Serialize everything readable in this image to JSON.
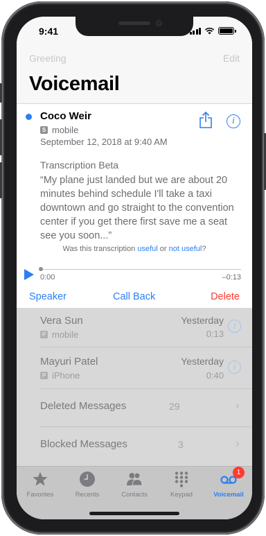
{
  "status": {
    "time": "9:41"
  },
  "nav": {
    "left_button": "Greeting",
    "right_button": "Edit",
    "title": "Voicemail"
  },
  "selected_voicemail": {
    "name": "Coco Weir",
    "label_badge": "S",
    "label": "mobile",
    "date": "September 12, 2018 at 9:40 AM",
    "transcription_heading": "Transcription Beta",
    "transcription": "“My plane just landed but we are about 20 minutes behind schedule I'll take a taxi downtown and go straight to the convention center if you get there first save me a seat see you soon...”",
    "feedback_prefix": "Was this transcription ",
    "feedback_useful": "useful",
    "feedback_or": " or ",
    "feedback_not_useful": "not useful",
    "feedback_suffix": "?",
    "elapsed": "0:00",
    "remaining": "–0:13",
    "progress": 0,
    "actions": {
      "speaker": "Speaker",
      "call_back": "Call Back",
      "delete": "Delete"
    }
  },
  "voicemails": [
    {
      "name": "Vera Sun",
      "badge": "P",
      "label": "mobile",
      "date": "Yesterday",
      "duration": "0:13"
    },
    {
      "name": "Mayuri Patel",
      "badge": "P",
      "label": "iPhone",
      "date": "Yesterday",
      "duration": "0:40"
    }
  ],
  "mailboxes": [
    {
      "name": "Deleted Messages",
      "count": "29"
    },
    {
      "name": "Blocked Messages",
      "count": "3"
    }
  ],
  "tabs": [
    {
      "label": "Favorites",
      "icon": "star-icon"
    },
    {
      "label": "Recents",
      "icon": "clock-icon"
    },
    {
      "label": "Contacts",
      "icon": "contacts-icon"
    },
    {
      "label": "Keypad",
      "icon": "keypad-icon"
    },
    {
      "label": "Voicemail",
      "icon": "voicemail-icon",
      "badge": "1",
      "active": true
    }
  ],
  "colors": {
    "accent": "#2b7ff2",
    "destructive": "#ff3b30",
    "unread_dot": "#2b7ff2"
  }
}
